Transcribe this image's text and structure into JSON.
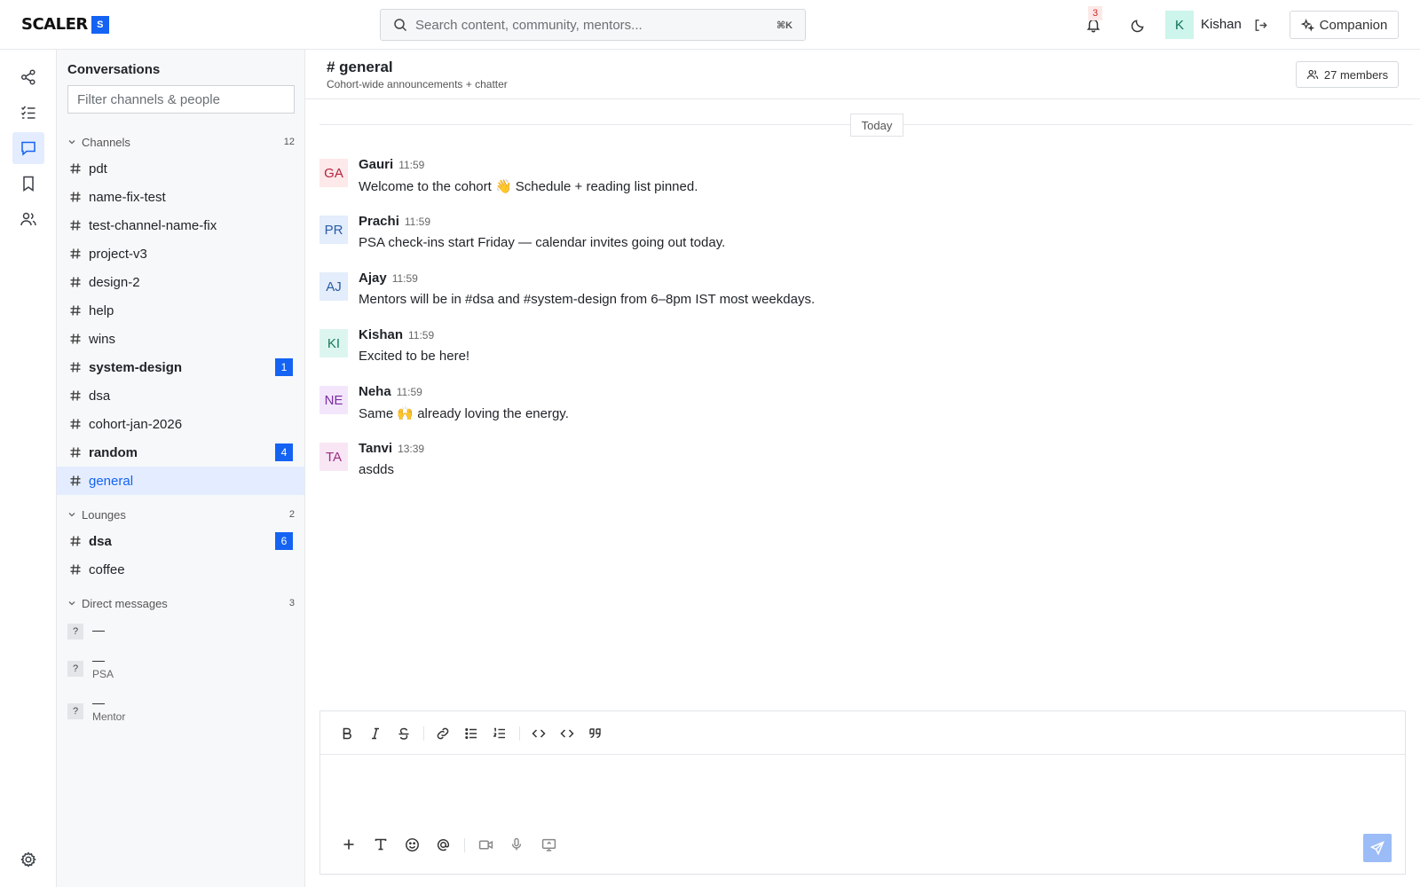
{
  "brand": {
    "name": "SCALER",
    "badge": "S",
    "accent": "#1463f3"
  },
  "search": {
    "placeholder": "Search content, community, mentors...",
    "shortcut": "⌘K"
  },
  "notifications": {
    "count": "3"
  },
  "user": {
    "initial": "K",
    "name": "Kishan"
  },
  "companion": {
    "label": "Companion"
  },
  "rail": {
    "items": [
      "share-icon",
      "task-list-icon",
      "chat-icon",
      "bookmark-icon",
      "people-icon"
    ],
    "active": "chat-icon",
    "bottom": "gear-icon"
  },
  "sidebar": {
    "title": "Conversations",
    "filter_placeholder": "Filter channels & people",
    "channels": {
      "label": "Channels",
      "count": "12",
      "items": [
        {
          "name": "pdt"
        },
        {
          "name": "name-fix-test"
        },
        {
          "name": "test-channel-name-fix"
        },
        {
          "name": "project-v3"
        },
        {
          "name": "design-2"
        },
        {
          "name": "help"
        },
        {
          "name": "wins"
        },
        {
          "name": "system-design",
          "unread": "1"
        },
        {
          "name": "dsa"
        },
        {
          "name": "cohort-jan-2026"
        },
        {
          "name": "random",
          "unread": "4"
        },
        {
          "name": "general",
          "active": true
        }
      ]
    },
    "lounges": {
      "label": "Lounges",
      "count": "2",
      "items": [
        {
          "name": "dsa",
          "unread": "6"
        },
        {
          "name": "coffee"
        }
      ]
    },
    "dms": {
      "label": "Direct messages",
      "count": "3",
      "items": [
        {
          "avatar": "?",
          "name": "—",
          "sub": ""
        },
        {
          "avatar": "?",
          "name": "—",
          "sub": "PSA"
        },
        {
          "avatar": "?",
          "name": "—",
          "sub": "Mentor"
        }
      ]
    }
  },
  "channel": {
    "title": "# general",
    "description": "Cohort-wide announcements + chatter",
    "members": "27 members",
    "day_label": "Today"
  },
  "messages": [
    {
      "initials": "GA",
      "author": "Gauri",
      "time": "11:59",
      "text": "Welcome to the cohort 👋  Schedule + reading list pinned.",
      "bg": "#fde8ea",
      "fg": "#b4233c"
    },
    {
      "initials": "PR",
      "author": "Prachi",
      "time": "11:59",
      "text": "PSA check-ins start Friday — calendar invites going out today.",
      "bg": "#e3edfb",
      "fg": "#2a5ca8"
    },
    {
      "initials": "AJ",
      "author": "Ajay",
      "time": "11:59",
      "text": "Mentors will be in #dsa and #system-design from 6–8pm IST most weekdays.",
      "bg": "#e3edfb",
      "fg": "#2a5ca8"
    },
    {
      "initials": "KI",
      "author": "Kishan",
      "time": "11:59",
      "text": "Excited to be here!",
      "bg": "#dcf6ef",
      "fg": "#137a5d"
    },
    {
      "initials": "NE",
      "author": "Neha",
      "time": "11:59",
      "text": "Same 🙌  already loving the energy.",
      "bg": "#f3e6fb",
      "fg": "#7a2ea3"
    },
    {
      "initials": "TA",
      "author": "Tanvi",
      "time": "13:39",
      "text": "asdds",
      "bg": "#f8e6f4",
      "fg": "#9c2d83"
    }
  ],
  "composer": {
    "toolbar": [
      "bold-icon",
      "italic-icon",
      "strikethrough-icon",
      "link-icon",
      "bullet-list-icon",
      "numbered-list-icon",
      "code-icon",
      "code-block-icon",
      "quote-icon"
    ],
    "bottom": [
      "plus-icon",
      "text-format-icon",
      "emoji-icon",
      "mention-icon",
      "video-icon",
      "mic-icon",
      "screen-share-icon"
    ],
    "send": "send-icon"
  }
}
